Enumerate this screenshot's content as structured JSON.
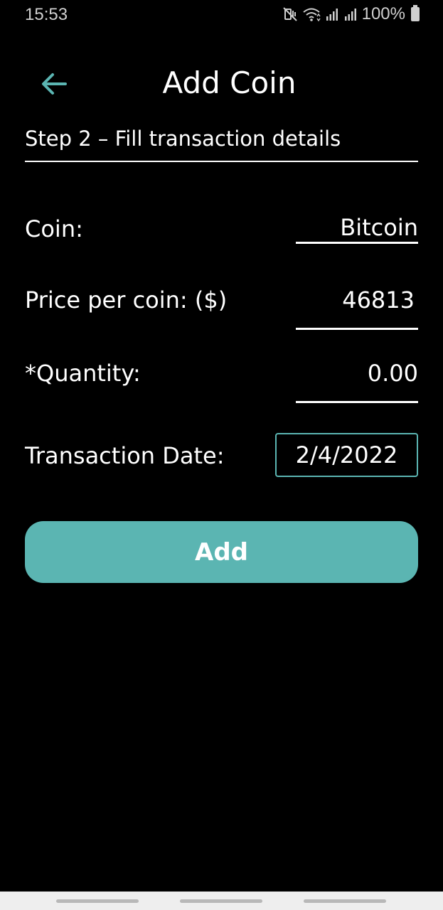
{
  "status_bar": {
    "time": "15:53",
    "battery": "100%",
    "icons": [
      "mute-vibrate-icon",
      "wifi-icon",
      "signal-icon",
      "signal-icon",
      "battery-icon"
    ]
  },
  "header": {
    "title": "Add Coin",
    "back_icon": "arrow-left-icon"
  },
  "subtitle": "Step 2 – Fill transaction details",
  "form": {
    "coin": {
      "label": "Coin:",
      "value": "Bitcoin"
    },
    "price": {
      "label": "Price per coin: ($)",
      "value": "46813"
    },
    "quantity": {
      "label": "*Quantity:",
      "value": "0.00"
    },
    "date": {
      "label": "Transaction Date:",
      "value": "2/4/2022"
    }
  },
  "add_button": {
    "label": "Add"
  },
  "colors": {
    "accent": "#5bb5b2",
    "background": "#000000",
    "text": "#ffffff"
  }
}
